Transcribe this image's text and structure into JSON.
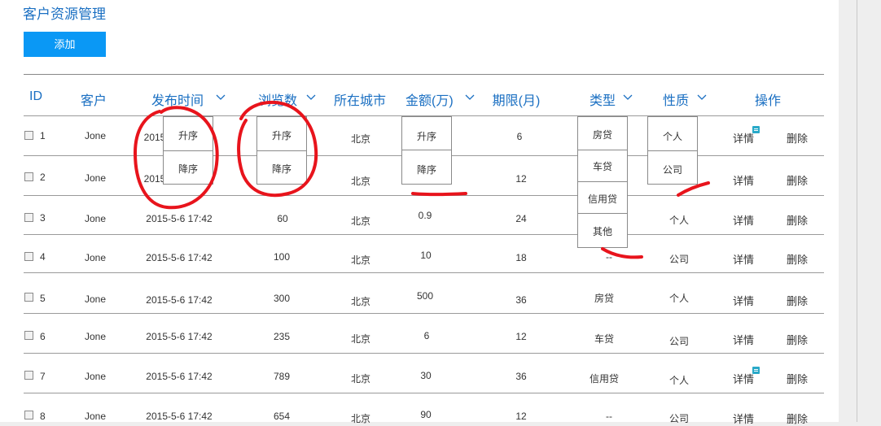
{
  "page": {
    "title": "客户资源管理",
    "add_label": "添加"
  },
  "headers": {
    "id": "ID",
    "customer": "客户",
    "time": "发布时间",
    "views": "浏览数",
    "city": "所在城市",
    "amount": "金额(万)",
    "term": "期限(月)",
    "type": "类型",
    "nature": "性质",
    "action": "操作"
  },
  "actions": {
    "detail": "详情",
    "delete": "删除"
  },
  "rows": [
    {
      "id": "1",
      "customer": "Jone",
      "time": "2015",
      "views": "",
      "city": "北京",
      "amount": "",
      "term": "6",
      "type": "",
      "nature": "",
      "detail_badge": true
    },
    {
      "id": "2",
      "customer": "Jone",
      "time": "2015",
      "views": "",
      "city": "北京",
      "amount": "",
      "term": "12",
      "type": "",
      "nature": "",
      "detail_badge": false
    },
    {
      "id": "3",
      "customer": "Jone",
      "time": "2015-5-6 17:42",
      "views": "60",
      "city": "北京",
      "amount": "0.9",
      "term": "24",
      "type": "",
      "nature": "个人",
      "detail_badge": false
    },
    {
      "id": "4",
      "customer": "Jone",
      "time": "2015-5-6 17:42",
      "views": "100",
      "city": "北京",
      "amount": "10",
      "term": "18",
      "type": "--",
      "nature": "公司",
      "detail_badge": false
    },
    {
      "id": "5",
      "customer": "Jone",
      "time": "2015-5-6 17:42",
      "views": "300",
      "city": "北京",
      "amount": "500",
      "term": "36",
      "type": "房贷",
      "nature": "个人",
      "detail_badge": false
    },
    {
      "id": "6",
      "customer": "Jone",
      "time": "2015-5-6 17:42",
      "views": "235",
      "city": "北京",
      "amount": "6",
      "term": "12",
      "type": "车贷",
      "nature": "公司",
      "detail_badge": false
    },
    {
      "id": "7",
      "customer": "Jone",
      "time": "2015-5-6 17:42",
      "views": "789",
      "city": "北京",
      "amount": "30",
      "term": "36",
      "type": "信用贷",
      "nature": "个人",
      "detail_badge": true
    },
    {
      "id": "8",
      "customer": "Jone",
      "time": "2015-5-6 17:42",
      "views": "654",
      "city": "北京",
      "amount": "90",
      "term": "12",
      "type": "--",
      "nature": "公司",
      "detail_badge": false
    }
  ],
  "dropdowns": {
    "time_sort": [
      "升序",
      "降序"
    ],
    "views_sort": [
      "升序",
      "降序"
    ],
    "amount_sort": [
      "升序",
      "降序"
    ],
    "type_filter": [
      "房贷",
      "车贷",
      "信用贷",
      "其他"
    ],
    "nature_filter": [
      "个人",
      "公司"
    ]
  },
  "colors": {
    "accent": "#1a6fc2",
    "button": "#0a98f5",
    "annotation": "#e8141c",
    "badge": "#29a9c8"
  }
}
